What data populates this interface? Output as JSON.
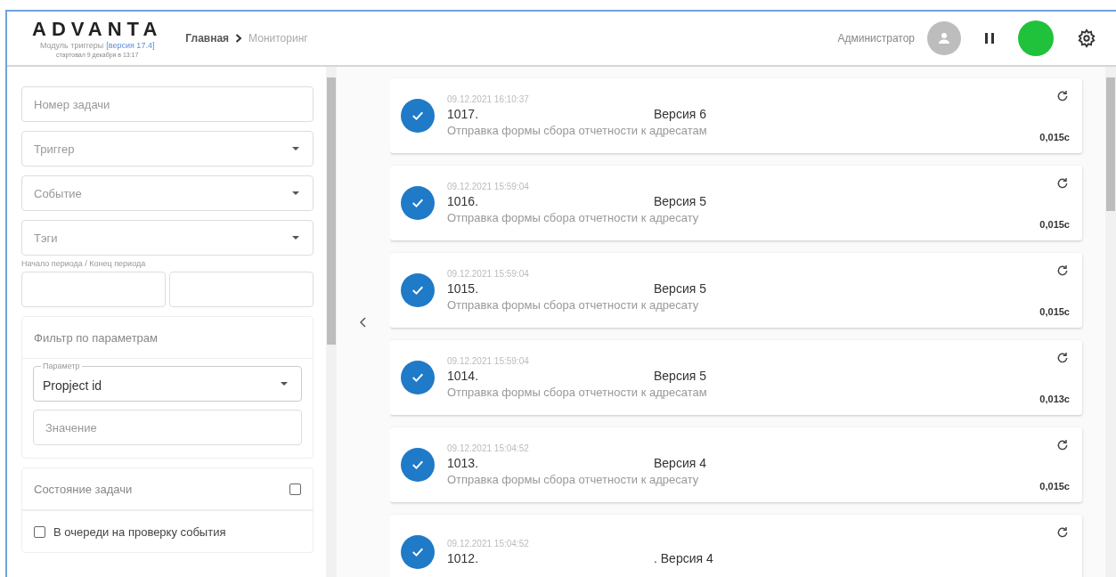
{
  "header": {
    "logo": "ADVANTA",
    "module": "Модуль триггеры",
    "version": "[версия 17.4]",
    "started": "стартовал 9 декабря в 13:17",
    "breadcrumbs": [
      {
        "label": "Главная",
        "selected": false
      },
      {
        "label": "Мониторинг",
        "selected": true
      }
    ],
    "user": "Администратор",
    "status_indicator": {
      "color": "#1fc23a"
    }
  },
  "filters": {
    "fields": [
      {
        "kind": "text",
        "placeholder": "Номер задачи"
      },
      {
        "kind": "select",
        "placeholder": "Триггер"
      },
      {
        "kind": "select",
        "placeholder": "Событие"
      },
      {
        "kind": "select",
        "placeholder": "Тэги"
      }
    ],
    "period_label": "Начало периода / Конец периода",
    "param_filter": {
      "title": "Фильтр по параметрам",
      "param_label": "Параметр",
      "param_value": "Propject id",
      "value_placeholder": "Значение"
    },
    "state": {
      "title": "Состояние задачи",
      "checked": false,
      "options": [
        {
          "label": "В очереди на проверку события",
          "checked": false
        }
      ]
    }
  },
  "tasks": [
    {
      "time": "09.12.2021 16:10:37",
      "id": "1017.",
      "version": "Версия 6",
      "description": "Отправка формы сбора отчетности к адресатам",
      "duration": "0,015с"
    },
    {
      "time": "09.12.2021 15:59:04",
      "id": "1016.",
      "version": "Версия 5",
      "description": "Отправка формы сбора отчетности к адресату",
      "duration": "0,015с"
    },
    {
      "time": "09.12.2021 15:59:04",
      "id": "1015.",
      "version": "Версия 5",
      "description": "Отправка формы сбора отчетности к адресату",
      "duration": "0,015с"
    },
    {
      "time": "09.12.2021 15:59:04",
      "id": "1014.",
      "version": "Версия 5",
      "description": "Отправка формы сбора отчетности к адресатам",
      "duration": "0,013с"
    },
    {
      "time": "09.12.2021 15:04:52",
      "id": "1013.",
      "version": "Версия 4",
      "description": "Отправка формы сбора отчетности к адресату",
      "duration": "0,015с"
    },
    {
      "time": "09.12.2021 15:04:52",
      "id": "1012.",
      "version": ". Версия 4"
    }
  ]
}
